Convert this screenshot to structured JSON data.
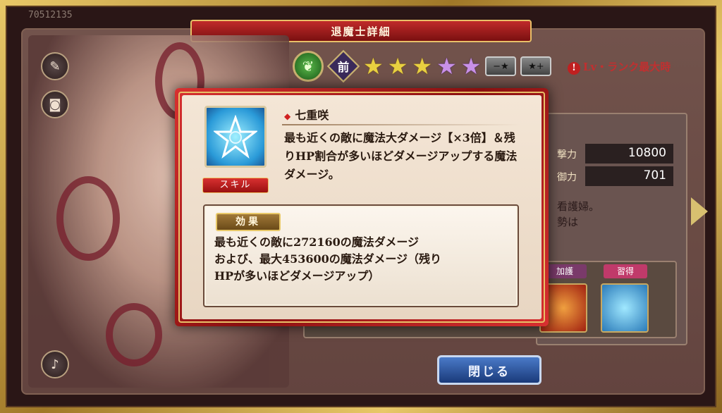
{
  "header": {
    "title": "退魔士詳細",
    "user_id": "70512135"
  },
  "rank": {
    "class_label": "前",
    "stars": [
      {
        "color": "gold"
      },
      {
        "color": "gold"
      },
      {
        "color": "gold"
      },
      {
        "color": "purple"
      },
      {
        "color": "purple"
      }
    ],
    "minus_star_label": "−★",
    "plus_star_label": "★+",
    "lv_note": "Lv・ランク最大時"
  },
  "stats": {
    "attack": {
      "label": "撃力",
      "value": "10800"
    },
    "defense": {
      "label": "御力",
      "value": "701"
    }
  },
  "profile_peek": [
    "看護婦。",
    "勢は"
  ],
  "slots": {
    "tag_divine": "加護",
    "tag_learn": "習得"
  },
  "close_label": "閉じる",
  "popup": {
    "skill_tag": "スキル",
    "skill_name": "七重咲",
    "skill_desc": "最も近くの敵に魔法大ダメージ【×3倍】＆残りHP割合が多いほどダメージアップする魔法ダメージ。",
    "effect_tag": "効果",
    "effect_lines": [
      "最も近くの敵に272160の魔法ダメージ",
      "および、最大453600の魔法ダメージ（残り",
      "HPが多いほどダメージアップ）"
    ]
  },
  "colors": {
    "accent_red": "#c02a2a",
    "gold": "#e8c068",
    "close_blue": "#2a5aa8"
  }
}
